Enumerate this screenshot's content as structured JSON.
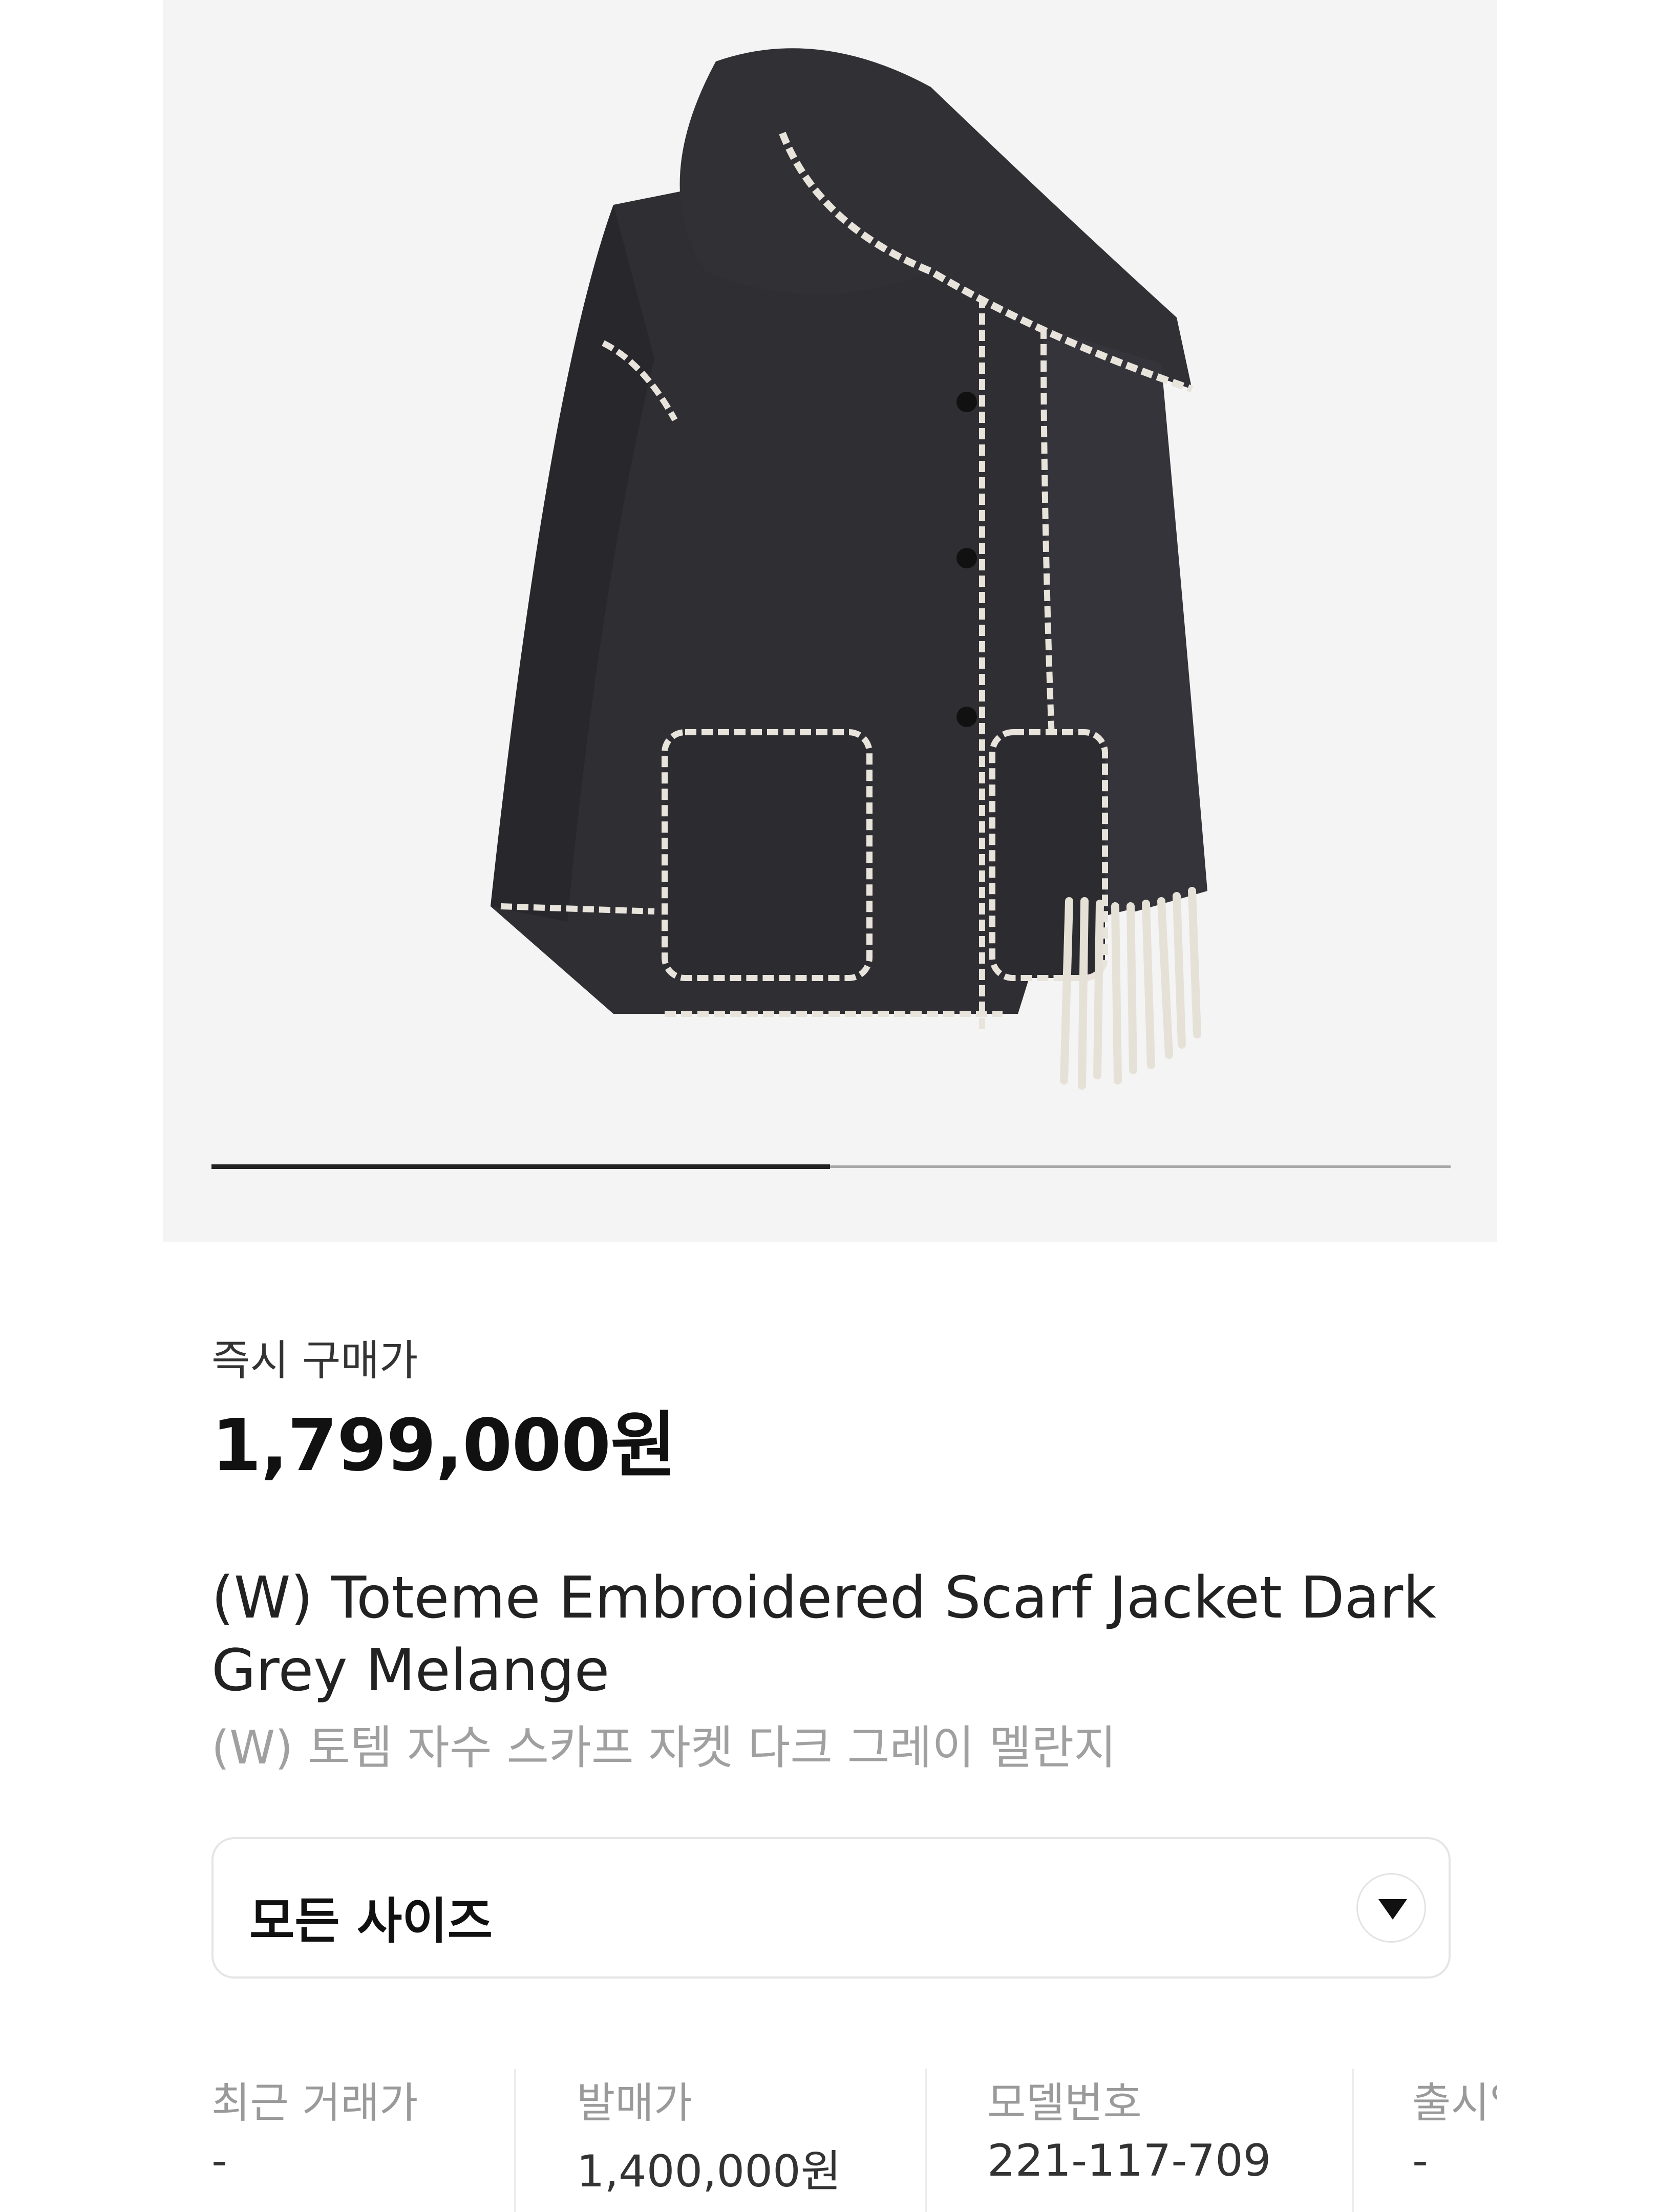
{
  "product": {
    "image_alt": "jacket-photo",
    "pager": {
      "current": 1,
      "total": 2
    }
  },
  "price": {
    "label": "즉시 구매가",
    "value": "1,799,000원"
  },
  "title": {
    "en": "(W) Toteme Embroidered Scarf Jacket Dark Grey Melange",
    "ko": "(W) 토템 자수 스카프 자켓 다크 그레이 멜란지"
  },
  "size_select": {
    "label": "모든 사이즈",
    "icon": "chevron-down-icon"
  },
  "info": [
    {
      "key": "최근 거래가",
      "value": "-"
    },
    {
      "key": "발매가",
      "value": "1,400,000원"
    },
    {
      "key": "모델번호",
      "value": "221-117-709"
    },
    {
      "key": "출시일",
      "value": "-"
    }
  ],
  "colors": {
    "jacket": "#2f2f33",
    "stitch": "#e8e4dc",
    "hero_bg": "#f4f4f4"
  }
}
